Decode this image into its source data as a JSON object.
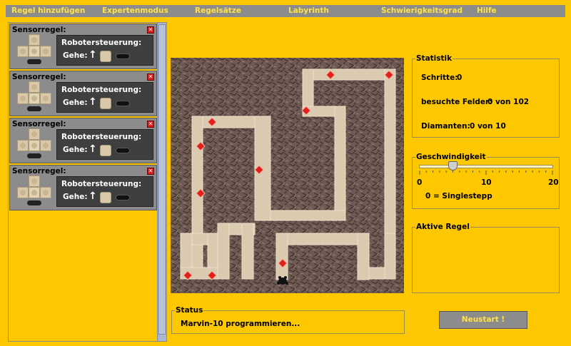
{
  "menu": {
    "items": [
      {
        "label": "Regel hinzufügen"
      },
      {
        "label": "Expertenmodus"
      },
      {
        "label": "Regelsätze"
      },
      {
        "label": "Labyrinth"
      },
      {
        "label": "Schwierigkeitsgrad"
      },
      {
        "label": "Hilfe"
      }
    ]
  },
  "rules": [
    {
      "title": "Sensorregel:",
      "control_label": "Robotersteuerung:",
      "action_label": "Gehe:",
      "action_arrow": "↑"
    },
    {
      "title": "Sensorregel:",
      "control_label": "Robotersteuerung:",
      "action_label": "Gehe:",
      "action_arrow": "↑"
    },
    {
      "title": "Sensorregel:",
      "control_label": "Robotersteuerung:",
      "action_label": "Gehe:",
      "action_arrow": "↑"
    },
    {
      "title": "Sensorregel:",
      "control_label": "Robotersteuerung:",
      "action_label": "Gehe:",
      "action_arrow": "↑"
    }
  ],
  "stats": {
    "title": "Statistik",
    "steps_label": "Schritte:",
    "steps_value": "0",
    "visited_label": "besuchte Felder:",
    "visited_value": "0 von 102",
    "diamonds_label": "Diamanten:",
    "diamonds_value": "0 von 10"
  },
  "speed": {
    "title": "Geschwindigkeit",
    "min_label": "0",
    "mid_label": "10",
    "max_label": "20",
    "value": 5,
    "min": 0,
    "max": 20,
    "note": "0 = Singlestepp"
  },
  "active_rule": {
    "title": "Aktive Regel"
  },
  "status": {
    "title": "Status",
    "text": "Marvin-10 programmieren..."
  },
  "restart_button": "Neustart !",
  "colors": {
    "background": "#fec800",
    "menu_bar": "#8c8c8c",
    "menu_text": "#ffe24a",
    "wall": "#6e5a52",
    "path": "#d9cab0",
    "diamond": "#e0201a"
  },
  "icons": {
    "delete": "close-icon",
    "diamond": "diamond-icon",
    "robot": "robot-icon",
    "arrow": "arrow-up-icon"
  }
}
